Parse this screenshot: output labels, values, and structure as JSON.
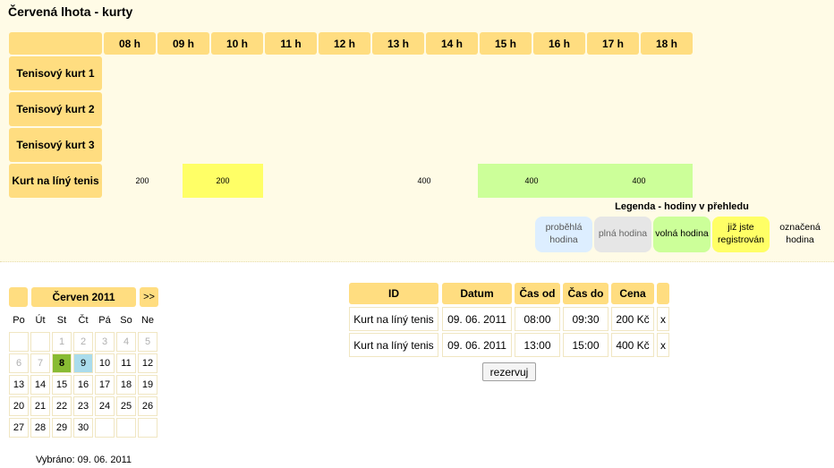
{
  "title": "Červená lhota - kurty",
  "schedule": {
    "hours": [
      "08 h",
      "09 h",
      "10 h",
      "11 h",
      "12 h",
      "13 h",
      "14 h",
      "15 h",
      "16 h",
      "17 h",
      "18 h"
    ],
    "courts": [
      "Tenisový kurt 1",
      "Tenisový kurt 2",
      "Tenisový kurt 3",
      "Kurt na líný tenis"
    ],
    "bookings": [
      {
        "court": 3,
        "start": 0,
        "span": 1.5,
        "label": "200",
        "status": "selected"
      },
      {
        "court": 3,
        "start": 1.5,
        "span": 1.5,
        "label": "200",
        "status": "mine"
      },
      {
        "court": 3,
        "start": 5,
        "span": 2,
        "label": "400",
        "status": "selected"
      },
      {
        "court": 3,
        "start": 7,
        "span": 2,
        "label": "400",
        "status": "free"
      },
      {
        "court": 3,
        "start": 9,
        "span": 2,
        "label": "400",
        "status": "free"
      }
    ]
  },
  "legend": {
    "title": "Legenda - hodiny v přehledu",
    "items": [
      {
        "label": "proběhlá hodina",
        "status": "past"
      },
      {
        "label": "plná hodina",
        "status": "full"
      },
      {
        "label": "volná hodina",
        "status": "free"
      },
      {
        "label": "již jste registrován",
        "status": "mine"
      },
      {
        "label": "označená hodina",
        "status": "selected"
      }
    ]
  },
  "colors": {
    "free": "#ccff99",
    "full": "#e6e6e6",
    "mine": "#ffff66",
    "selected": "#99dd77",
    "past": "#ddeeff",
    "header": "#ffdd80"
  },
  "calendar": {
    "month_label": "Červen 2011",
    "next_label": ">>",
    "weekdays": [
      "Po",
      "Út",
      "St",
      "Čt",
      "Pá",
      "So",
      "Ne"
    ],
    "weeks": [
      [
        "",
        "",
        "1",
        "2",
        "3",
        "4",
        "5"
      ],
      [
        "6",
        "7",
        "8",
        "9",
        "10",
        "11",
        "12"
      ],
      [
        "13",
        "14",
        "15",
        "16",
        "17",
        "18",
        "19"
      ],
      [
        "20",
        "21",
        "22",
        "23",
        "24",
        "25",
        "26"
      ],
      [
        "27",
        "28",
        "29",
        "30",
        "",
        "",
        ""
      ]
    ],
    "past_days": [
      "1",
      "2",
      "3",
      "4",
      "5",
      "6",
      "7"
    ],
    "today": "8",
    "selected_day": "9",
    "selected_text": "Vybráno: 09. 06. 2011"
  },
  "reservations": {
    "headers": [
      "ID",
      "Datum",
      "Čas od",
      "Čas do",
      "Cena",
      ""
    ],
    "rows": [
      [
        "Kurt na líný tenis",
        "09. 06. 2011",
        "08:00",
        "09:30",
        "200 Kč",
        "x"
      ],
      [
        "Kurt na líný tenis",
        "09. 06. 2011",
        "13:00",
        "15:00",
        "400 Kč",
        "x"
      ]
    ],
    "reserve_label": "rezervuj"
  }
}
